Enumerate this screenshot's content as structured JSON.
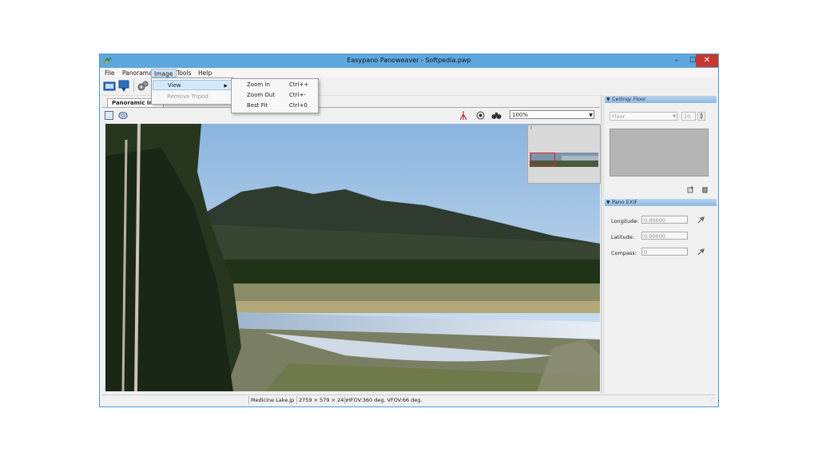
{
  "window": {
    "title": "Easypano Panoweaver - Softpedia.pwp",
    "minimize_glyph": "–",
    "maximize_glyph": "☐",
    "close_glyph": "✕",
    "border_color": "#4a9ad4",
    "titlebar_color": "#5ea7dd"
  },
  "menubar": {
    "items": [
      "File",
      "Panorama",
      "Image",
      "Tools",
      "Help"
    ],
    "active": "Image"
  },
  "toolbar": {
    "icons": [
      "new-panorama-icon",
      "save-panorama-icon",
      "settings-gears-icon"
    ]
  },
  "image_menu": {
    "items": [
      {
        "label": "View",
        "has_submenu": true,
        "highlighted": true
      },
      {
        "label": "Remove Tripod",
        "enabled": false
      }
    ]
  },
  "view_submenu": {
    "items": [
      {
        "label": "Zoom In",
        "shortcut": "Ctrl++"
      },
      {
        "label": "Zoom Out",
        "shortcut": "Ctrl+-"
      },
      {
        "label": "Best Fit",
        "shortcut": "Ctrl+0"
      }
    ]
  },
  "left_panel": {
    "tab_label": "Panoramic Ima",
    "zoom_value": "100%",
    "view_icons": [
      "rectangle-select-icon",
      "sphere-view-icon"
    ],
    "tool_icons": [
      "tripod-icon",
      "target-icon",
      "binoculars-icon"
    ]
  },
  "ceiling_floor": {
    "header": "Ceiling/ Floor",
    "type_value": "Floor",
    "size_value": "20",
    "icons": [
      "import-image-icon",
      "delete-trash-icon"
    ]
  },
  "pano_exif": {
    "header": "Pano EXIF",
    "longitude_label": "Longitude:",
    "longitude_value": "0.00000",
    "latitude_label": "Latitude:",
    "latitude_value": "0.00000",
    "compass_label": "Compass:",
    "compass_value": "0"
  },
  "statusbar": {
    "filename": "Medicine Lake.jp",
    "dimensions": "2759 × 579 × 24b",
    "fov": "HFOV:360 deg. VFOV:66 deg."
  }
}
